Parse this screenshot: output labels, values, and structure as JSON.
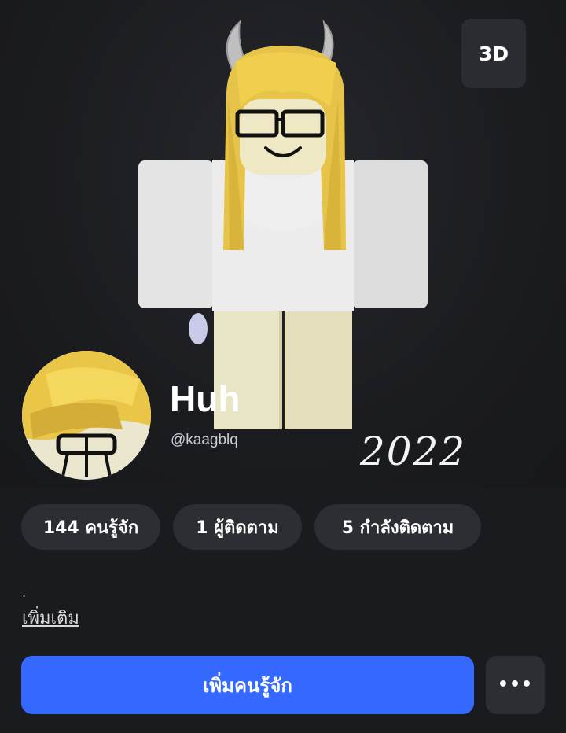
{
  "view_toggle": {
    "label": "3D"
  },
  "profile": {
    "display_name": "Huh",
    "username": "@kaagblq",
    "overlay_text": "2022",
    "bio": ".",
    "more_label": "เพิ่มเติม"
  },
  "stats": [
    {
      "label": "144 คนรู้จัก"
    },
    {
      "label": "1 ผู้ติดตาม"
    },
    {
      "label": "5 กำลังติดตาม"
    }
  ],
  "actions": {
    "add_friend_label": "เพิ่มคนรู้จัก",
    "more_options_label": "•••"
  },
  "colors": {
    "background": "#1a1b1f",
    "primary_button": "#3468ff",
    "chip": "#2c2e34"
  }
}
